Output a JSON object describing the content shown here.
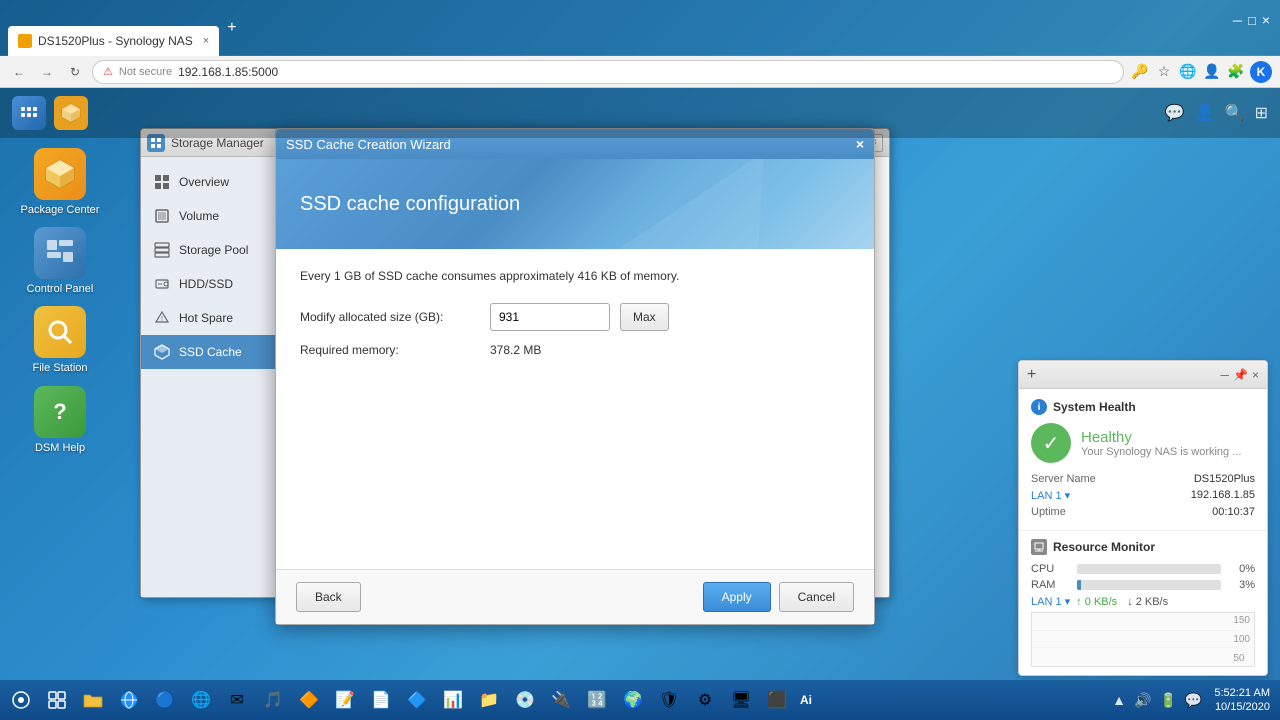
{
  "browser": {
    "tab_title": "DS1520Plus - Synology NAS",
    "tab_close": "×",
    "tab_new": "+",
    "nav_back": "←",
    "nav_forward": "→",
    "nav_refresh": "↻",
    "address": "192.168.1.85:5000",
    "lock_label": "Not secure",
    "profile_initial": "K"
  },
  "storage_manager": {
    "title": "Storage Manager",
    "sidebar": {
      "items": [
        {
          "id": "overview",
          "label": "Overview",
          "icon": "☰"
        },
        {
          "id": "volume",
          "label": "Volume",
          "icon": "⬛"
        },
        {
          "id": "storage-pool",
          "label": "Storage Pool",
          "icon": "▦"
        },
        {
          "id": "hdd-ssd",
          "label": "HDD/SSD",
          "icon": "💾"
        },
        {
          "id": "hot-spare",
          "label": "Hot Spare",
          "icon": "🔧"
        },
        {
          "id": "ssd-cache",
          "label": "SSD Cache",
          "icon": "⚡"
        }
      ]
    }
  },
  "wizard": {
    "title": "SSD Cache Creation Wizard",
    "close_btn": "×",
    "header_title": "SSD cache configuration",
    "info_text": "Every 1 GB of SSD cache consumes approximately 416 KB of memory.",
    "form": {
      "size_label": "Modify allocated size (GB):",
      "size_value": "931",
      "max_btn": "Max",
      "memory_label": "Required memory:",
      "memory_value": "378.2 MB"
    },
    "footer": {
      "back_btn": "Back",
      "apply_btn": "Apply",
      "cancel_btn": "Cancel"
    }
  },
  "system_health": {
    "section_title": "System Health",
    "status": "Healthy",
    "status_sub": "Your Synology NAS is working ...",
    "server_name_label": "Server Name",
    "server_name_value": "DS1520Plus",
    "lan_label": "LAN 1",
    "lan_arrow": "▾",
    "lan_value": "192.168.1.85",
    "uptime_label": "Uptime",
    "uptime_value": "00:10:37"
  },
  "resource_monitor": {
    "section_title": "Resource Monitor",
    "cpu_label": "CPU",
    "cpu_pct": "0%",
    "cpu_fill": 0,
    "ram_label": "RAM",
    "ram_pct": "3%",
    "ram_fill": 3,
    "lan_label": "LAN 1",
    "lan_arrow": "▾",
    "lan_up": "↑ 0 KB/s",
    "lan_down": "↓ 2 KB/s",
    "chart_labels": [
      "150",
      "100",
      "50"
    ]
  },
  "taskbar_bottom": {
    "ai_label": "Ai",
    "time": "5:52:21 AM",
    "date": "10/15/2020"
  },
  "desktop_icons": [
    {
      "id": "package-center",
      "label": "Package\nCenter",
      "icon": "📦",
      "class": "icon-package"
    },
    {
      "id": "control-panel",
      "label": "Control Panel",
      "icon": "🖥",
      "class": "icon-control"
    },
    {
      "id": "file-station",
      "label": "File Station",
      "icon": "🔍",
      "class": "icon-file"
    },
    {
      "id": "dsm-help",
      "label": "DSM Help",
      "icon": "?",
      "class": "icon-help"
    }
  ]
}
